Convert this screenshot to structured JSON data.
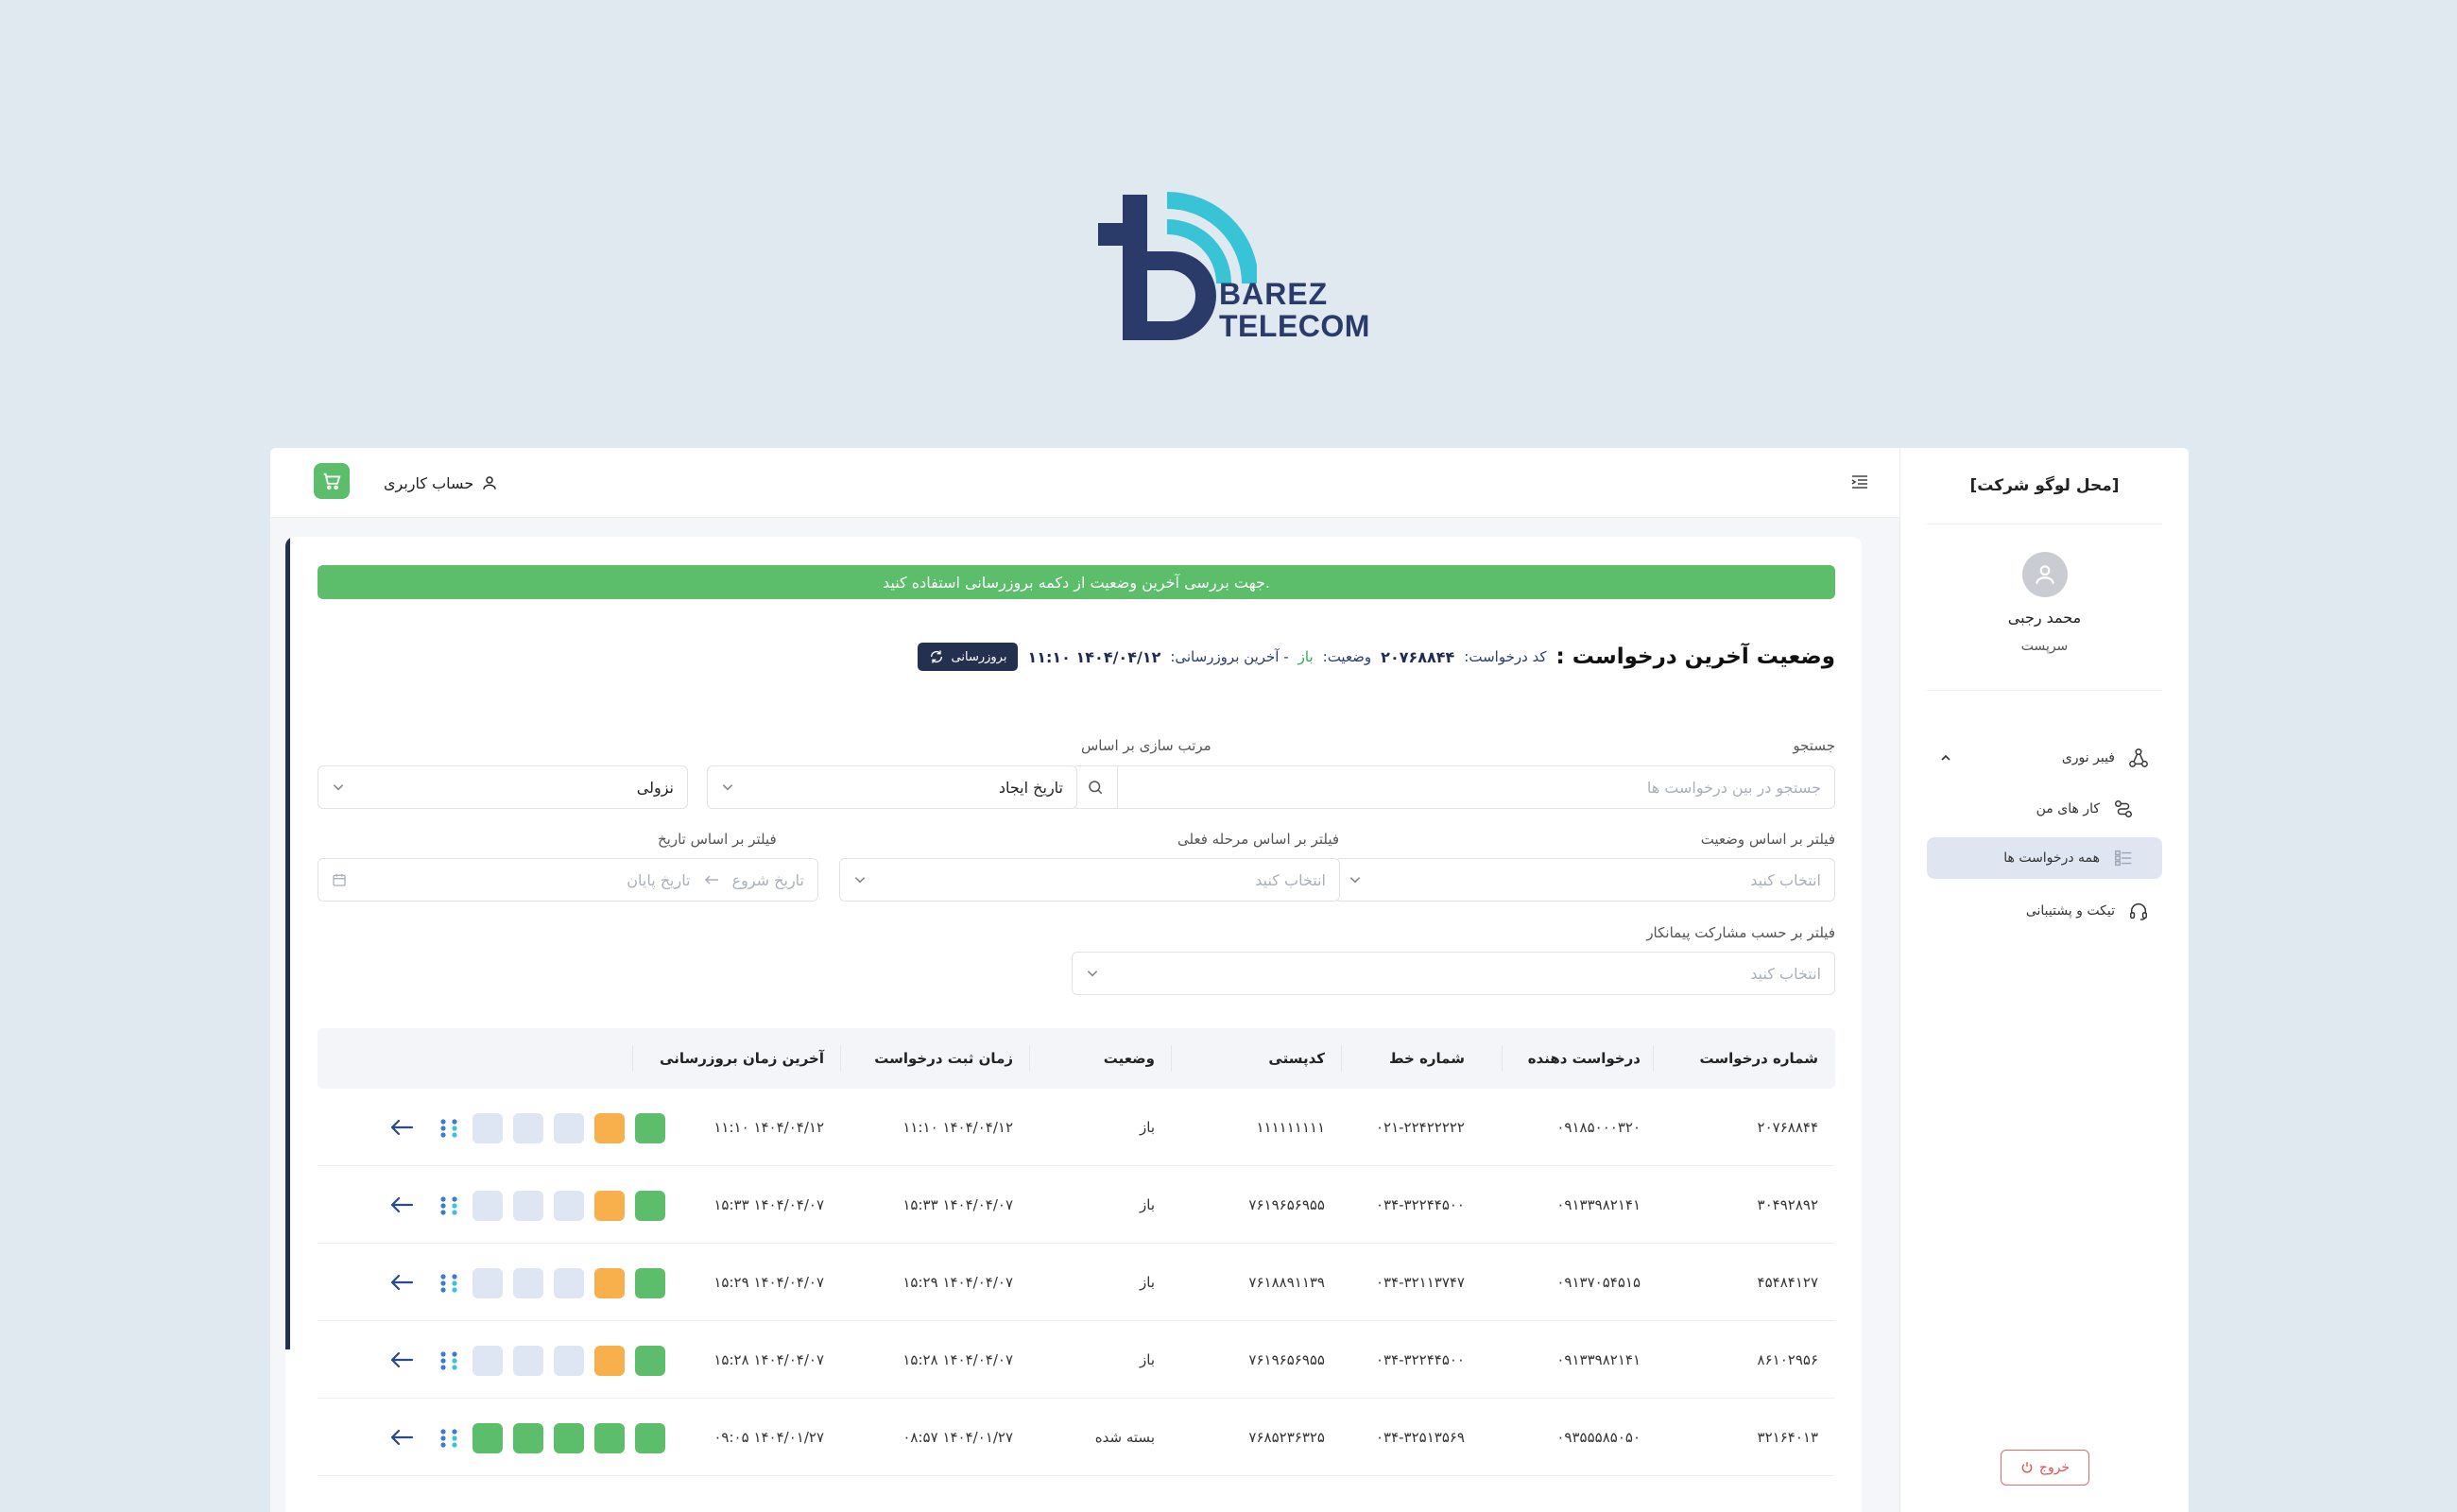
{
  "brand": {
    "line1": "BAREZ",
    "line2": "TELECOM"
  },
  "sidebar": {
    "logo_placeholder": "[محل لوگو شرکت]",
    "user_name": "محمد رجبی",
    "user_role": "سرپست",
    "items": [
      {
        "label": "فیبر نوری"
      },
      {
        "label": "کار های من"
      },
      {
        "label": "همه درخواست ها"
      },
      {
        "label": "تیکت و پشتیبانی"
      }
    ],
    "logout_label": "خروج"
  },
  "topbar": {
    "account_label": "حساب کاربری"
  },
  "notice": "جهت بررسی آخرین وضعیت از دکمه بروزرسانی استفاده کنید.",
  "status": {
    "heading": "وضعیت آخرین درخواست :",
    "code_label": "کد درخواست:",
    "code_value": "۲۰۷۶۸۸۴۴",
    "state_label": "وضعیت:",
    "state_value": "باز",
    "updated_label": "- آخرین بروزرسانی:",
    "updated_value": "۱۴۰۴/۰۴/۱۲ ۱۱:۱۰",
    "refresh_label": "بروزرسانی"
  },
  "filters": {
    "search_label": "جستجو",
    "search_placeholder": "جستجو در بین درخواست ها",
    "sort_label": "مرتب سازی بر اساس",
    "sort_value": "تاریخ ایجاد",
    "order_value": "نزولی",
    "status_label": "فیلتر بر اساس وضعیت",
    "status_placeholder": "انتخاب کنید",
    "stage_label": "فیلتر بر اساس مرحله فعلی",
    "stage_placeholder": "انتخاب کنید",
    "date_label": "فیلتر بر اساس تاریخ",
    "date_start": "تاریخ شروع",
    "date_end": "تاریخ پایان",
    "contractor_label": "فیلتر بر حسب مشارکت پیمانکار",
    "contractor_placeholder": "انتخاب کنید"
  },
  "table": {
    "headers": [
      "شماره درخواست",
      "درخواست دهنده",
      "شماره خط",
      "کدپستی",
      "وضعیت",
      "زمان ثبت درخواست",
      "آخرین زمان بروزرسانی"
    ],
    "rows": [
      {
        "id": "۲۰۷۶۸۸۴۴",
        "requester": "۰۹۱۸۵۰۰۰۳۲۰",
        "line": "۰۲۱-۲۲۴۲۲۲۲۲",
        "postal": "۱۱۱۱۱۱۱۱۱",
        "status": "باز",
        "created": "۱۴۰۴/۰۴/۱۲ ۱۱:۱۰",
        "updated": "۱۴۰۴/۰۴/۱۲ ۱۱:۱۰",
        "steps": [
          "green",
          "orange",
          "grey",
          "grey",
          "grey"
        ]
      },
      {
        "id": "۳۰۴۹۲۸۹۲",
        "requester": "۰۹۱۳۳۹۸۲۱۴۱",
        "line": "۰۳۴-۳۲۲۴۴۵۰۰",
        "postal": "۷۶۱۹۶۵۶۹۵۵",
        "status": "باز",
        "created": "۱۴۰۴/۰۴/۰۷ ۱۵:۳۳",
        "updated": "۱۴۰۴/۰۴/۰۷ ۱۵:۳۳",
        "steps": [
          "green",
          "orange",
          "grey",
          "grey",
          "grey"
        ]
      },
      {
        "id": "۴۵۴۸۴۱۲۷",
        "requester": "۰۹۱۳۷۰۵۴۵۱۵",
        "line": "۰۳۴-۳۲۱۱۳۷۴۷",
        "postal": "۷۶۱۸۸۹۱۱۳۹",
        "status": "باز",
        "created": "۱۴۰۴/۰۴/۰۷ ۱۵:۲۹",
        "updated": "۱۴۰۴/۰۴/۰۷ ۱۵:۲۹",
        "steps": [
          "green",
          "orange",
          "grey",
          "grey",
          "grey"
        ]
      },
      {
        "id": "۸۶۱۰۲۹۵۶",
        "requester": "۰۹۱۳۳۹۸۲۱۴۱",
        "line": "۰۳۴-۳۲۲۴۴۵۰۰",
        "postal": "۷۶۱۹۶۵۶۹۵۵",
        "status": "باز",
        "created": "۱۴۰۴/۰۴/۰۷ ۱۵:۲۸",
        "updated": "۱۴۰۴/۰۴/۰۷ ۱۵:۲۸",
        "steps": [
          "green",
          "orange",
          "grey",
          "grey",
          "grey"
        ]
      },
      {
        "id": "۳۲۱۶۴۰۱۳",
        "requester": "۰۹۳۵۵۵۸۵۰۵۰",
        "line": "۰۳۴-۳۲۵۱۳۵۶۹",
        "postal": "۷۶۸۵۲۳۶۳۲۵",
        "status": "بسته شده",
        "created": "۱۴۰۴/۰۱/۲۷ ۰۸:۵۷",
        "updated": "۱۴۰۴/۰۱/۲۷ ۰۹:۰۵",
        "steps": [
          "green",
          "green",
          "green",
          "green",
          "green"
        ]
      }
    ]
  },
  "colors": {
    "accent_green": "#5cbd6a",
    "accent_orange": "#f8b04c",
    "navy": "#23304f",
    "step_grey": "#dde6f2",
    "logo_cyan": "#39c3d6"
  }
}
